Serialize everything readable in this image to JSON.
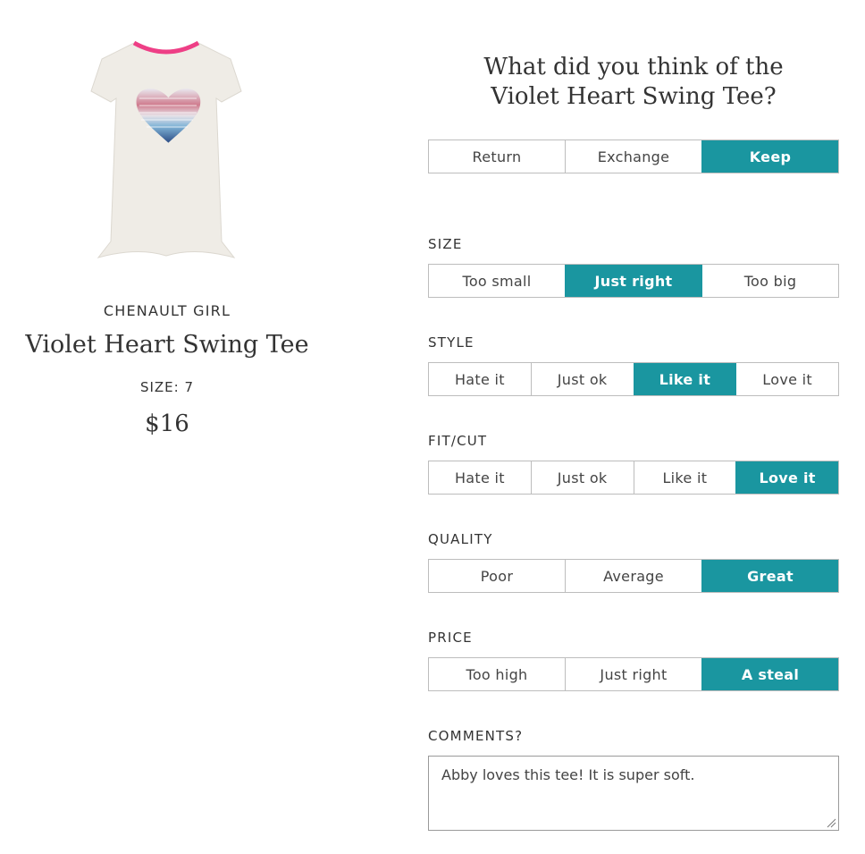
{
  "product": {
    "brand": "CHENAULT GIRL",
    "name": "Violet Heart Swing Tee",
    "size": "SIZE: 7",
    "price": "$16"
  },
  "question": {
    "line1": "What did you think of the",
    "line2": "Violet Heart Swing Tee?"
  },
  "decision": {
    "options": [
      "Return",
      "Exchange",
      "Keep"
    ],
    "selected": "Keep"
  },
  "size": {
    "label": "SIZE",
    "options": [
      "Too small",
      "Just right",
      "Too big"
    ],
    "selected": "Just right"
  },
  "style": {
    "label": "STYLE",
    "options": [
      "Hate it",
      "Just ok",
      "Like it",
      "Love it"
    ],
    "selected": "Like it"
  },
  "fit": {
    "label": "FIT/CUT",
    "options": [
      "Hate it",
      "Just ok",
      "Like it",
      "Love it"
    ],
    "selected": "Love it"
  },
  "quality": {
    "label": "QUALITY",
    "options": [
      "Poor",
      "Average",
      "Great"
    ],
    "selected": "Great"
  },
  "price": {
    "label": "PRICE",
    "options": [
      "Too high",
      "Just right",
      "A steal"
    ],
    "selected": "A steal"
  },
  "comments": {
    "label": "COMMENTS?",
    "value": "Abby loves this tee! It is super soft."
  },
  "colors": {
    "accent": "#1a96a0",
    "neckline": "#ee3f86"
  }
}
